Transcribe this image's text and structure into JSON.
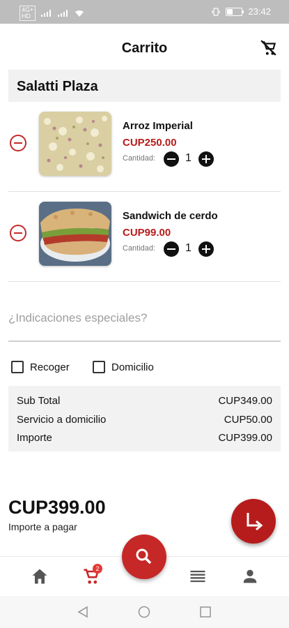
{
  "status_bar": {
    "sim1": "4G+",
    "sim2": "HD",
    "time": "23:42"
  },
  "app_bar": {
    "title": "Carrito",
    "clear_icon": "remove-shopping-cart-icon"
  },
  "store": {
    "name": "Salatti Plaza"
  },
  "items": [
    {
      "name": "Arroz Imperial",
      "price": "CUP250.00",
      "qty_label": "Cantidad:",
      "qty": "1",
      "image": "rice-dish"
    },
    {
      "name": "Sandwich de cerdo",
      "price": "CUP99.00",
      "qty_label": "Cantidad:",
      "qty": "1",
      "image": "pork-sandwich"
    }
  ],
  "instructions": {
    "placeholder": "¿Indicaciones especiales?"
  },
  "delivery_options": [
    {
      "label": "Recoger",
      "checked": false
    },
    {
      "label": "Domicilio",
      "checked": false
    }
  ],
  "summary": {
    "rows": [
      {
        "label": "Sub Total",
        "value": "CUP349.00"
      },
      {
        "label": "Servicio a domicilio",
        "value": "CUP50.00"
      },
      {
        "label": "Importe",
        "value": "CUP399.00"
      }
    ]
  },
  "total": {
    "amount": "CUP399.00",
    "caption": "Importe a pagar"
  },
  "bottom_nav": {
    "cart_badge": "2",
    "items": [
      "home-icon",
      "cart-icon",
      "list-icon",
      "person-icon"
    ]
  },
  "colors": {
    "accent": "#b71c1c",
    "fab": "#c62828",
    "status_bar": "#bdbdbd"
  }
}
